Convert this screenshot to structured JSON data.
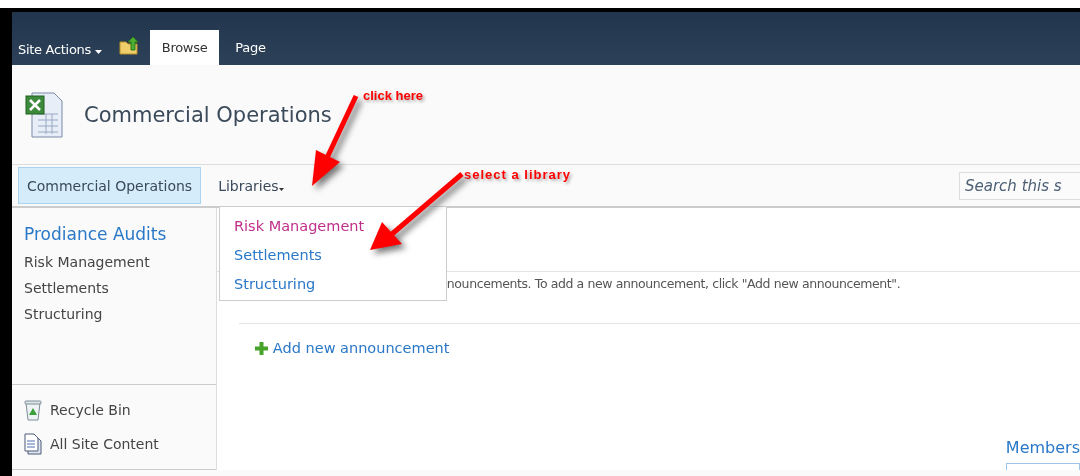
{
  "ribbon": {
    "site_actions": "Site Actions",
    "tabs": [
      {
        "label": "Browse",
        "selected": true
      },
      {
        "label": "Page",
        "selected": false
      }
    ]
  },
  "site": {
    "title": "Commercial Operations"
  },
  "top_nav": {
    "items": [
      {
        "label": "Commercial Operations",
        "selected": true,
        "kind": "link"
      },
      {
        "label": "Libraries",
        "selected": false,
        "kind": "menu"
      }
    ],
    "search": {
      "placeholder": "Search this s"
    }
  },
  "dropdown": {
    "items": [
      {
        "label": "Risk Management",
        "selected": true
      },
      {
        "label": "Settlements",
        "selected": false
      },
      {
        "label": "Structuring",
        "selected": false
      }
    ]
  },
  "quick_launch": {
    "heading": "Prodiance Audits",
    "items": [
      "Risk Management",
      "Settlements",
      "Structuring"
    ],
    "footer": [
      {
        "label": "Recycle Bin",
        "kind": "recycle"
      },
      {
        "label": "All Site Content",
        "kind": "content"
      }
    ]
  },
  "announcements": {
    "empty_text": "nouncements. To add a new announcement, click \"Add new announcement\".",
    "add_link": "Add new announcement"
  },
  "members": {
    "title": "Members"
  },
  "annotations": [
    {
      "text": "click here"
    },
    {
      "text": "select a library"
    }
  ]
}
